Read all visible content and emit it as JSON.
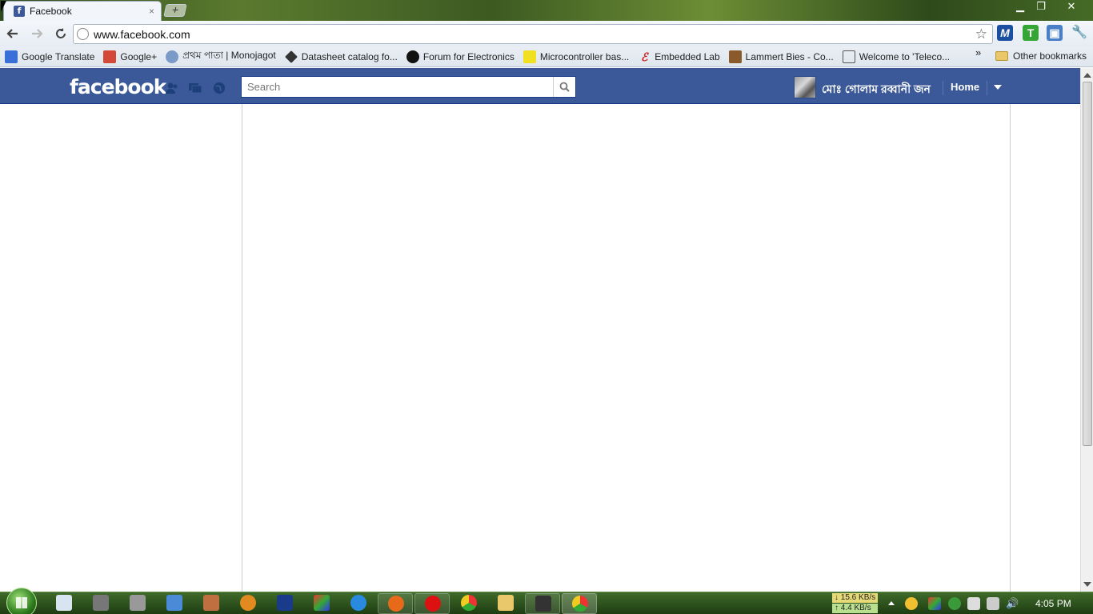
{
  "browser": {
    "tab_title": "Facebook",
    "tab_favicon": "f",
    "tab_close": "×",
    "new_tab": "+",
    "window_controls": {
      "minimize": "▁",
      "maximize": "❐",
      "close": "✕"
    },
    "url": "www.facebook.com",
    "bookmarks": [
      {
        "label": "Google Translate",
        "icon": "translate-icon",
        "color": "#3a6fd8"
      },
      {
        "label": "Google+",
        "icon": "googleplus-icon",
        "color": "#d34836"
      },
      {
        "label": "প্রথম পাতা | Monojagot",
        "icon": "monojagot-icon",
        "color": "#7a9ac8"
      },
      {
        "label": "Datasheet catalog fo...",
        "icon": "chip-icon",
        "color": "#333333"
      },
      {
        "label": "Forum for Electronics",
        "icon": "edaboard-icon",
        "color": "#111111"
      },
      {
        "label": "Microcontroller bas...",
        "icon": "microcontroller-icon",
        "color": "#f0e020"
      },
      {
        "label": "Embedded Lab",
        "icon": "embedded-lab-icon",
        "color": "#cc2222"
      },
      {
        "label": "Lammert Bies - Co...",
        "icon": "lammert-bies-icon",
        "color": "#8a5a2a"
      },
      {
        "label": "Welcome to 'Teleco...",
        "icon": "telecom-icon",
        "color": "#555555"
      }
    ],
    "bookmarks_more": "»",
    "other_bookmarks": "Other bookmarks"
  },
  "facebook": {
    "logo": "facebook",
    "search": {
      "placeholder": "Search",
      "value": ""
    },
    "user_name": "মোঃ গোলাম রব্বানী জন",
    "home_label": "Home",
    "brand_color": "#3b5998"
  },
  "taskbar": {
    "network": {
      "down": "15.6 KB/s",
      "up": "4.4 KB/s"
    },
    "clock": "4:05 PM"
  }
}
